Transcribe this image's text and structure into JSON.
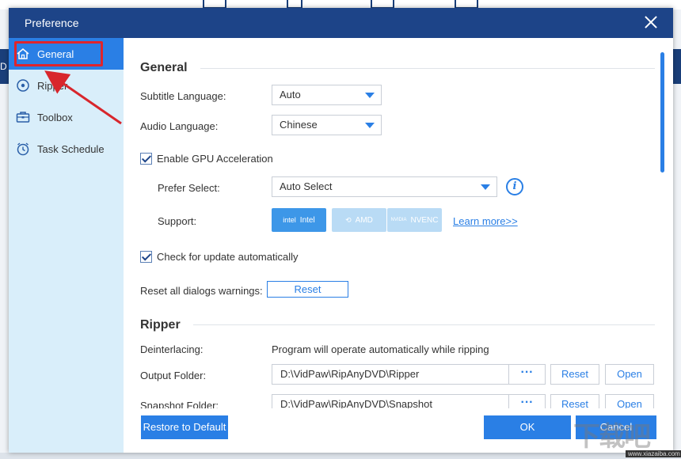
{
  "dialog": {
    "title": "Preference"
  },
  "sidebar": {
    "items": [
      {
        "label": "General",
        "icon": "home-icon",
        "active": true
      },
      {
        "label": "Ripper",
        "icon": "disc-icon",
        "active": false
      },
      {
        "label": "Toolbox",
        "icon": "toolbox-icon",
        "active": false
      },
      {
        "label": "Task Schedule",
        "icon": "clock-icon",
        "active": false
      }
    ]
  },
  "background": {
    "left_letter": "D"
  },
  "general": {
    "heading": "General",
    "subtitle_label": "Subtitle Language:",
    "subtitle_value": "Auto",
    "audio_label": "Audio Language:",
    "audio_value": "Chinese",
    "gpu_label": "Enable GPU Acceleration",
    "gpu_checked": true,
    "prefer_label": "Prefer Select:",
    "prefer_value": "Auto Select",
    "info_glyph": "i",
    "support_label": "Support:",
    "support_badges": [
      {
        "mark": "intel",
        "label": "Intel",
        "state": "enabled"
      },
      {
        "mark": "⟲",
        "label": "AMD",
        "state": "disabled"
      },
      {
        "mark": "NVIDIA",
        "label": "NVENC",
        "state": "disabled"
      }
    ],
    "learn_more": "Learn more>>",
    "update_label": "Check for update automatically",
    "update_checked": true,
    "reset_warnings_label": "Reset all dialogs warnings:",
    "reset_button": "Reset"
  },
  "ripper": {
    "heading": "Ripper",
    "deinterlacing_label": "Deinterlacing:",
    "deinterlacing_value": "Program will operate automatically while ripping",
    "output_label": "Output Folder:",
    "output_path": "D:\\VidPaw\\RipAnyDVD\\Ripper",
    "snapshot_label": "Snapshot Folder:",
    "snapshot_path": "D:\\VidPaw\\RipAnyDVD\\Snapshot",
    "browse_glyph": "···",
    "reset_label": "Reset",
    "open_label": "Open"
  },
  "footer": {
    "restore_label": "Restore to Default",
    "ok_label": "OK",
    "cancel_label": "Cancel"
  },
  "watermark": {
    "text": "下载吧",
    "sub": "www.xiazaiba.com"
  },
  "colors": {
    "titlebar": "#1d4488",
    "accent": "#2a7fe5",
    "sidebar": "#d9eefa",
    "highlight": "#e0242b"
  }
}
